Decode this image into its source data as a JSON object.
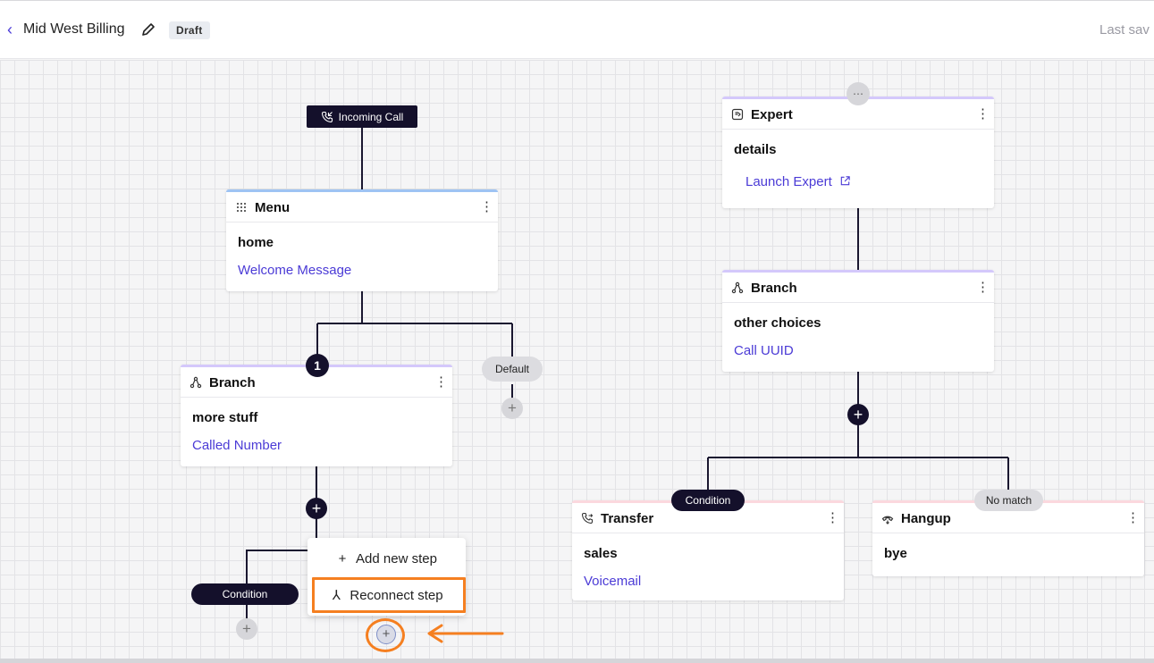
{
  "header": {
    "back_icon": "‹",
    "title": "Mid West Billing",
    "badge": "Draft",
    "last_saved": "Last sav"
  },
  "trigger": {
    "label": "Incoming Call",
    "icon": "phone-incoming-icon"
  },
  "cards": {
    "menu": {
      "type": "Menu",
      "name": "home",
      "sub": "Welcome Message",
      "icon": "grid-dots-icon",
      "kebab": "⋮"
    },
    "branch_left": {
      "type": "Branch",
      "name": "more stuff",
      "sub": "Called Number",
      "icon": "branch-icon",
      "kebab": "⋮"
    },
    "expert": {
      "type": "Expert",
      "name": "details",
      "sub": "Launch Expert",
      "icon": "expert-icon",
      "link_icon": "external-link-icon",
      "kebab": "⋮"
    },
    "branch_right": {
      "type": "Branch",
      "name": "other choices",
      "sub": "Call UUID",
      "icon": "branch-icon",
      "kebab": "⋮"
    },
    "transfer": {
      "type": "Transfer",
      "name": "sales",
      "sub": "Voicemail",
      "icon": "phone-transfer-icon",
      "kebab": "⋮"
    },
    "hangup": {
      "type": "Hangup",
      "name": "bye",
      "icon": "phone-hangup-icon",
      "kebab": "⋮"
    }
  },
  "pills": {
    "default": "Default",
    "condition_left": "Condition",
    "condition_right": "Condition",
    "no_match": "No match"
  },
  "badges": {
    "branch_number": "1",
    "plus": "+",
    "drag": "⋯"
  },
  "popup": {
    "add_new_step": "Add new step",
    "add_icon": "+",
    "reconnect_step": "Reconnect step",
    "reconnect_icon": "⅄"
  },
  "colors": {
    "accent": "#4b3bd6",
    "dark": "#14102b",
    "highlight": "#f57f20",
    "menu_accent": "#9ec3f3",
    "branch_accent": "#d4c8fb",
    "terminal_accent": "#fbd8de"
  }
}
